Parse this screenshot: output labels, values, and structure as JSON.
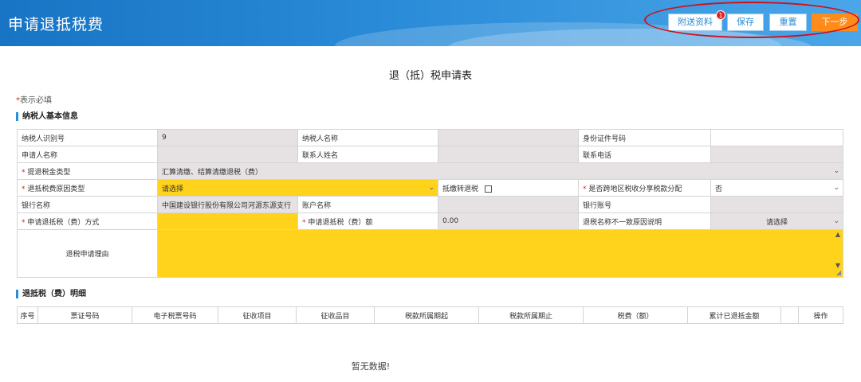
{
  "header": {
    "title": "申请退抵税费",
    "buttons": {
      "attach": "附送资料",
      "save": "保存",
      "reset": "重置",
      "next": "下一步"
    },
    "attach_badge": "1"
  },
  "form": {
    "title": "退（抵）税申请表",
    "required_star": "*",
    "required_note": "表示必填",
    "section_basic": "纳税人基本信息",
    "section_detail": "退抵税（费）明细"
  },
  "basic": {
    "taxpayer_id_label": "纳税人识别号",
    "taxpayer_id_value": "9",
    "taxpayer_name_label": "纳税人名称",
    "taxpayer_name_value": "",
    "id_number_label": "身份证件号码",
    "id_number_value": "",
    "applicant_label": "申请人名称",
    "applicant_value": "",
    "contact_name_label": "联系人姓名",
    "contact_name_value": "",
    "phone_label": "联系电话",
    "phone_value": "",
    "refund_type_label": "提退税金类型",
    "refund_type_value": "汇算清缴、结算清缴退税（费）",
    "reason_type_label": "退抵税费原因类型",
    "reason_type_value": "请选择",
    "transfer_label": "抵缴转退税",
    "cross_region_label": "是否跨地区税收分享税款分配",
    "cross_region_value": "否",
    "bank_name_label": "银行名称",
    "bank_name_value": "中国建设银行股份有限公司河源东源支行",
    "account_name_label": "账户名称",
    "account_name_value": "",
    "account_no_label": "银行账号",
    "account_no_value": "",
    "method_label": "申请退抵税（费）方式",
    "method_value": "",
    "amount_label": "申请退抵税（费）额",
    "amount_value": "0.00",
    "mismatch_label": "退税名称不一致原因说明",
    "mismatch_value": "请选择",
    "reason_label": "退税申请理由",
    "reason_value": ""
  },
  "detail": {
    "columns": [
      "序号",
      "票证号码",
      "电子税票号码",
      "征收项目",
      "征收品目",
      "税款所属期起",
      "税款所属期止",
      "税费（额）",
      "累计已退抵金额",
      "",
      "操作"
    ],
    "empty_text": "暂无数据!"
  },
  "colors": {
    "header_blue": "#2a8bd8",
    "next_orange": "#ff8c1a",
    "required_field_yellow": "#ffd21c",
    "readonly_gray": "#e6e2e3",
    "annotation_red": "#d0101a"
  }
}
